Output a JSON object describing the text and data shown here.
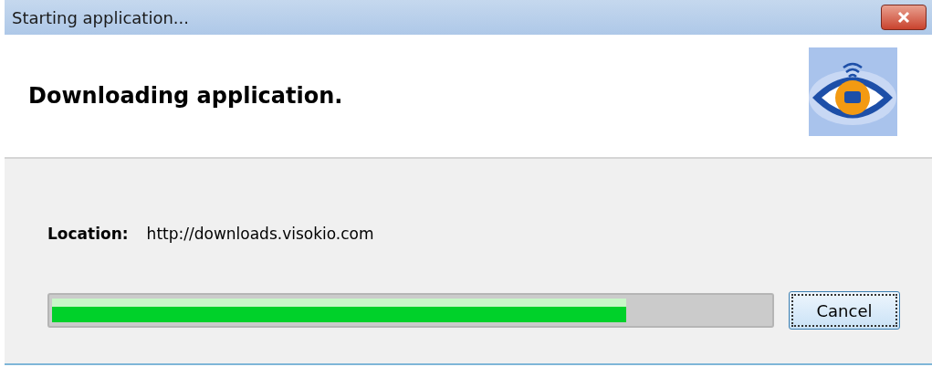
{
  "window": {
    "title": "Starting application..."
  },
  "header": {
    "heading": "Downloading application."
  },
  "location": {
    "label": "Location:",
    "value": "http://downloads.visokio.com"
  },
  "progress": {
    "level": 0.8
  },
  "buttons": [
    {
      "label": "Cancel",
      "kind": "default"
    }
  ]
}
